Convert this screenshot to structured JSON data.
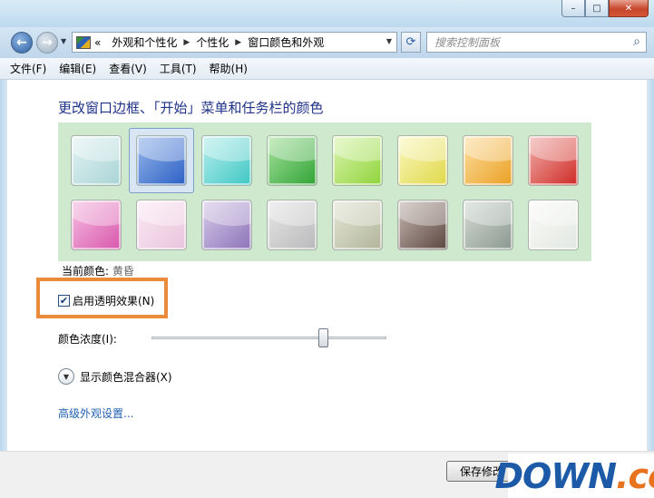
{
  "window": {
    "minimize_glyph": "–",
    "maximize_glyph": "□",
    "close_glyph": "✕"
  },
  "nav": {
    "back_glyph": "←",
    "forward_glyph": "→",
    "crumb_prefix": "«",
    "crumbs": [
      "外观和个性化",
      "个性化",
      "窗口颜色和外观"
    ],
    "search_placeholder": "搜索控制面板"
  },
  "menu": [
    "文件(F)",
    "编辑(E)",
    "查看(V)",
    "工具(T)",
    "帮助(H)"
  ],
  "main": {
    "title": "更改窗口边框、「开始」菜单和任务栏的颜色",
    "current_color_label": "当前颜色:",
    "current_color_value": "黄昏",
    "transparency_label": "启用透明效果(N)",
    "transparency_checked": true,
    "intensity_label": "颜色浓度(I):",
    "intensity_fraction": 0.73,
    "mixer_label": "显示颜色混合器(X)",
    "advanced_link": "高级外观设置..."
  },
  "swatches": [
    {
      "name": "sky",
      "colors": [
        "#e4f2f2",
        "#a9d4d6"
      ]
    },
    {
      "name": "twilight",
      "colors": [
        "#9ab9ec",
        "#2a5fc4"
      ],
      "selected": true
    },
    {
      "name": "sea",
      "colors": [
        "#b9efed",
        "#3fc7c3"
      ]
    },
    {
      "name": "leaf",
      "colors": [
        "#a9e3a2",
        "#2fa332"
      ]
    },
    {
      "name": "lime",
      "colors": [
        "#dcf5b0",
        "#8fd43b"
      ]
    },
    {
      "name": "lemon",
      "colors": [
        "#fbf8bf",
        "#e0d84a"
      ]
    },
    {
      "name": "pumpkin",
      "colors": [
        "#fce0a5",
        "#eba022"
      ]
    },
    {
      "name": "ruby",
      "colors": [
        "#f1b1ad",
        "#cf2a25"
      ]
    },
    {
      "name": "fuchsia",
      "colors": [
        "#f6bfe2",
        "#d857ac"
      ]
    },
    {
      "name": "blush",
      "colors": [
        "#fbeaf4",
        "#e9c4dc"
      ]
    },
    {
      "name": "violet",
      "colors": [
        "#d7ccea",
        "#8d73b9"
      ]
    },
    {
      "name": "lavender",
      "colors": [
        "#e7e7e7",
        "#b9b9bb"
      ]
    },
    {
      "name": "taupe",
      "colors": [
        "#e4e6d6",
        "#b2b59a"
      ]
    },
    {
      "name": "chocolate",
      "colors": [
        "#c7b9b2",
        "#5a4740"
      ]
    },
    {
      "name": "slate",
      "colors": [
        "#d5dcd6",
        "#8a9890"
      ]
    },
    {
      "name": "frost",
      "colors": [
        "#fbfbf9",
        "#e2e7e1"
      ]
    }
  ],
  "footer": {
    "save_label": "保存修改"
  },
  "watermark": {
    "part1": "DOWN",
    "part2": ".cc"
  }
}
